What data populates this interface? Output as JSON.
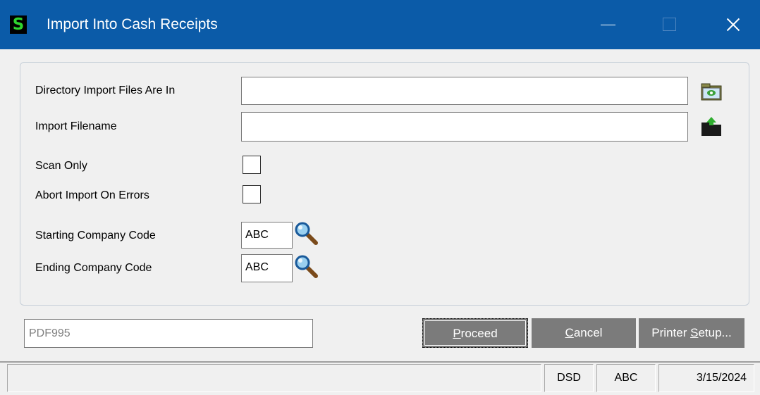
{
  "window": {
    "title": "Import Into Cash Receipts",
    "app_icon_glyph": "S",
    "titlebar_color": "#0b5ba8"
  },
  "form": {
    "directory_label": "Directory Import Files Are In",
    "directory_value": "",
    "filename_label": "Import Filename",
    "filename_value": "",
    "scan_only_label": "Scan Only",
    "scan_only_checked": false,
    "abort_label": "Abort Import On Errors",
    "abort_checked": false,
    "starting_company_label": "Starting Company Code",
    "starting_company_value": "ABC",
    "ending_company_label": "Ending Company Code",
    "ending_company_value": "ABC"
  },
  "icons": {
    "directory_browse": "folder-browse-icon",
    "filename_browse": "folder-upload-icon",
    "lookup": "magnifier-icon"
  },
  "footer": {
    "printer_value": "PDF995",
    "proceed_underlined": "P",
    "proceed_rest": "roceed",
    "cancel_underlined": "C",
    "cancel_rest": "ancel",
    "printer_setup_prefix": "Printer ",
    "printer_setup_underlined": "S",
    "printer_setup_rest": "etup...",
    "button_color": "#7b7b7b"
  },
  "status": {
    "message": "",
    "module": "DSD",
    "company": "ABC",
    "date": "3/15/2024"
  }
}
